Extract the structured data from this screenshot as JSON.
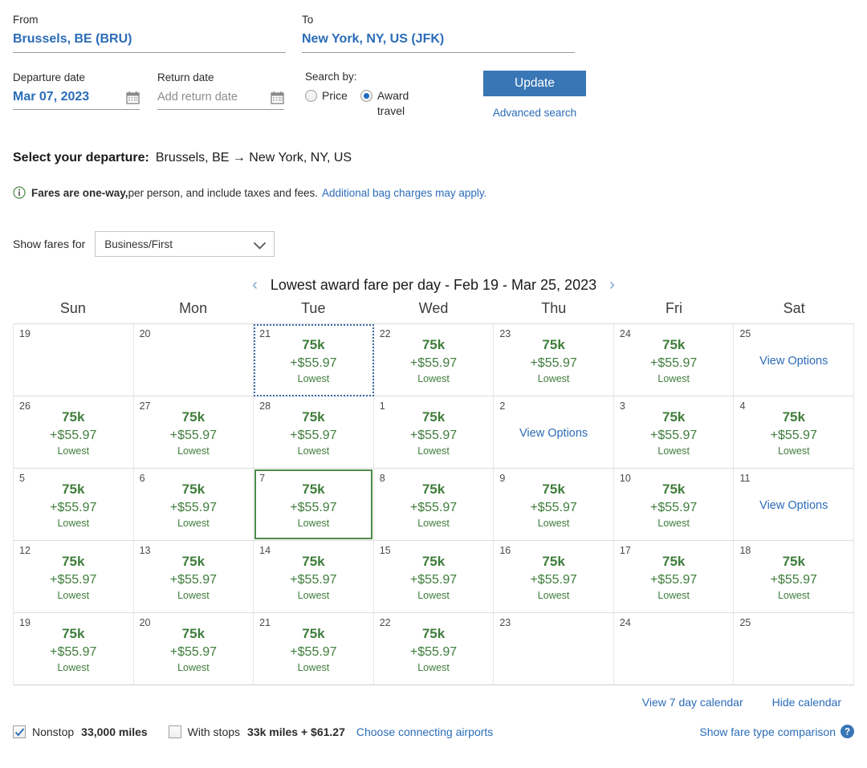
{
  "search_form": {
    "from_label": "From",
    "from_value": "Brussels, BE (BRU)",
    "to_label": "To",
    "to_value": "New York, NY, US (JFK)",
    "departure_label": "Departure date",
    "departure_value": "Mar 07, 2023",
    "return_label": "Return date",
    "return_placeholder": "Add return date",
    "search_by_label": "Search by:",
    "radio_price": "Price",
    "radio_award": "Award travel",
    "selected_radio": "Award travel",
    "update_label": "Update",
    "advanced_search": "Advanced search"
  },
  "heading": {
    "select_departure_label": "Select your departure:",
    "route": "Brussels, BE → New York, NY, US"
  },
  "fares_note": {
    "bold": "Fares are one-way,",
    "rest": " per person, and include taxes and fees.",
    "link": "Additional bag charges may apply."
  },
  "show_fares": {
    "label": "Show fares for",
    "selected": "Business/First"
  },
  "calendar": {
    "title": "Lowest award fare per day - Feb 19 - Mar 25, 2023",
    "prev_arrow": "‹",
    "next_arrow": "›",
    "day_headers": [
      "Sun",
      "Mon",
      "Tue",
      "Wed",
      "Thu",
      "Fri",
      "Sat"
    ],
    "view_options_label": "View Options",
    "lowest_label": "Lowest",
    "rows": [
      [
        {
          "day": "19",
          "state": "empty"
        },
        {
          "day": "20",
          "state": "empty"
        },
        {
          "day": "21",
          "state": "fare",
          "miles": "75k",
          "tax": "+$55.97",
          "focused": true
        },
        {
          "day": "22",
          "state": "fare",
          "miles": "75k",
          "tax": "+$55.97"
        },
        {
          "day": "23",
          "state": "fare",
          "miles": "75k",
          "tax": "+$55.97"
        },
        {
          "day": "24",
          "state": "fare",
          "miles": "75k",
          "tax": "+$55.97"
        },
        {
          "day": "25",
          "state": "options"
        }
      ],
      [
        {
          "day": "26",
          "state": "fare",
          "miles": "75k",
          "tax": "+$55.97"
        },
        {
          "day": "27",
          "state": "fare",
          "miles": "75k",
          "tax": "+$55.97"
        },
        {
          "day": "28",
          "state": "fare",
          "miles": "75k",
          "tax": "+$55.97"
        },
        {
          "day": "1",
          "state": "fare",
          "miles": "75k",
          "tax": "+$55.97"
        },
        {
          "day": "2",
          "state": "options"
        },
        {
          "day": "3",
          "state": "fare",
          "miles": "75k",
          "tax": "+$55.97"
        },
        {
          "day": "4",
          "state": "fare",
          "miles": "75k",
          "tax": "+$55.97"
        }
      ],
      [
        {
          "day": "5",
          "state": "fare",
          "miles": "75k",
          "tax": "+$55.97"
        },
        {
          "day": "6",
          "state": "fare",
          "miles": "75k",
          "tax": "+$55.97"
        },
        {
          "day": "7",
          "state": "fare",
          "miles": "75k",
          "tax": "+$55.97",
          "selected": true
        },
        {
          "day": "8",
          "state": "fare",
          "miles": "75k",
          "tax": "+$55.97"
        },
        {
          "day": "9",
          "state": "fare",
          "miles": "75k",
          "tax": "+$55.97"
        },
        {
          "day": "10",
          "state": "fare",
          "miles": "75k",
          "tax": "+$55.97"
        },
        {
          "day": "11",
          "state": "options"
        }
      ],
      [
        {
          "day": "12",
          "state": "fare",
          "miles": "75k",
          "tax": "+$55.97"
        },
        {
          "day": "13",
          "state": "fare",
          "miles": "75k",
          "tax": "+$55.97"
        },
        {
          "day": "14",
          "state": "fare",
          "miles": "75k",
          "tax": "+$55.97"
        },
        {
          "day": "15",
          "state": "fare",
          "miles": "75k",
          "tax": "+$55.97"
        },
        {
          "day": "16",
          "state": "fare",
          "miles": "75k",
          "tax": "+$55.97"
        },
        {
          "day": "17",
          "state": "fare",
          "miles": "75k",
          "tax": "+$55.97"
        },
        {
          "day": "18",
          "state": "fare",
          "miles": "75k",
          "tax": "+$55.97"
        }
      ],
      [
        {
          "day": "19",
          "state": "fare",
          "miles": "75k",
          "tax": "+$55.97"
        },
        {
          "day": "20",
          "state": "fare",
          "miles": "75k",
          "tax": "+$55.97"
        },
        {
          "day": "21",
          "state": "fare",
          "miles": "75k",
          "tax": "+$55.97"
        },
        {
          "day": "22",
          "state": "fare",
          "miles": "75k",
          "tax": "+$55.97"
        },
        {
          "day": "23",
          "state": "empty"
        },
        {
          "day": "24",
          "state": "empty"
        },
        {
          "day": "25",
          "state": "empty"
        }
      ]
    ]
  },
  "calendar_links": {
    "view_7_day": "View 7 day calendar",
    "hide_calendar": "Hide calendar"
  },
  "bottom_bar": {
    "nonstop_label": "Nonstop",
    "nonstop_value": "33,000 miles",
    "nonstop_checked": true,
    "with_stops_label": "With stops",
    "with_stops_value": "33k miles + $61.27",
    "with_stops_checked": false,
    "choose_airports": "Choose connecting airports",
    "compare_link": "Show fare type comparison"
  },
  "colors": {
    "link_blue": "#2b6cb8",
    "fare_green": "#3f7d3c",
    "button_blue": "#3876b5",
    "selected_border": "#4b8a48"
  }
}
